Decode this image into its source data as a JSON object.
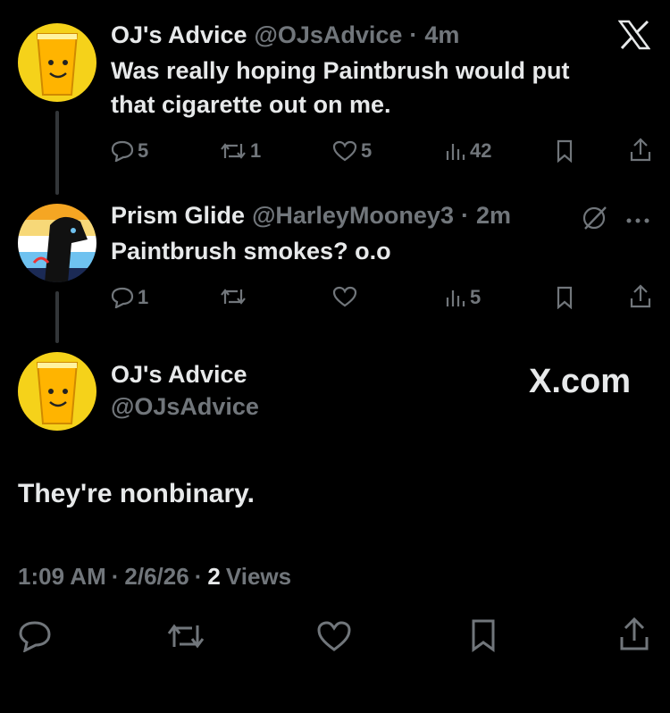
{
  "tweets": [
    {
      "name": "OJ's Advice",
      "handle": "@OJsAdvice",
      "dot": "·",
      "time": "4m",
      "text_line1": "Was really hoping Paintbrush would put",
      "text_line2": "that cigarette out on me.",
      "replies": "5",
      "retweets": "1",
      "likes": "5",
      "views": "42"
    },
    {
      "name": "Prism Glide",
      "handle": "@HarleyMooney3",
      "dot": "·",
      "time": "2m",
      "text_line1": "Paintbrush smokes? o.o",
      "replies": "1",
      "retweets": "",
      "likes": "",
      "views": "5"
    }
  ],
  "main_tweet": {
    "name": "OJ's Advice",
    "handle": "@OJsAdvice",
    "text": "They're nonbinary.",
    "time": "1:09 AM",
    "date": "2/6/26",
    "dot": "·",
    "views_count": "2",
    "views_label": "Views"
  },
  "brand": {
    "logo_text": "X.com"
  },
  "colors": {
    "background": "#000000",
    "text": "#e7e9ea",
    "muted": "#71767b",
    "avatar_yellow": "#f5d21a"
  },
  "icons": [
    "x-logo-icon",
    "reply-icon",
    "retweet-icon",
    "like-icon",
    "views-icon",
    "bookmark-icon",
    "share-icon",
    "more-icon",
    "grok-icon"
  ]
}
